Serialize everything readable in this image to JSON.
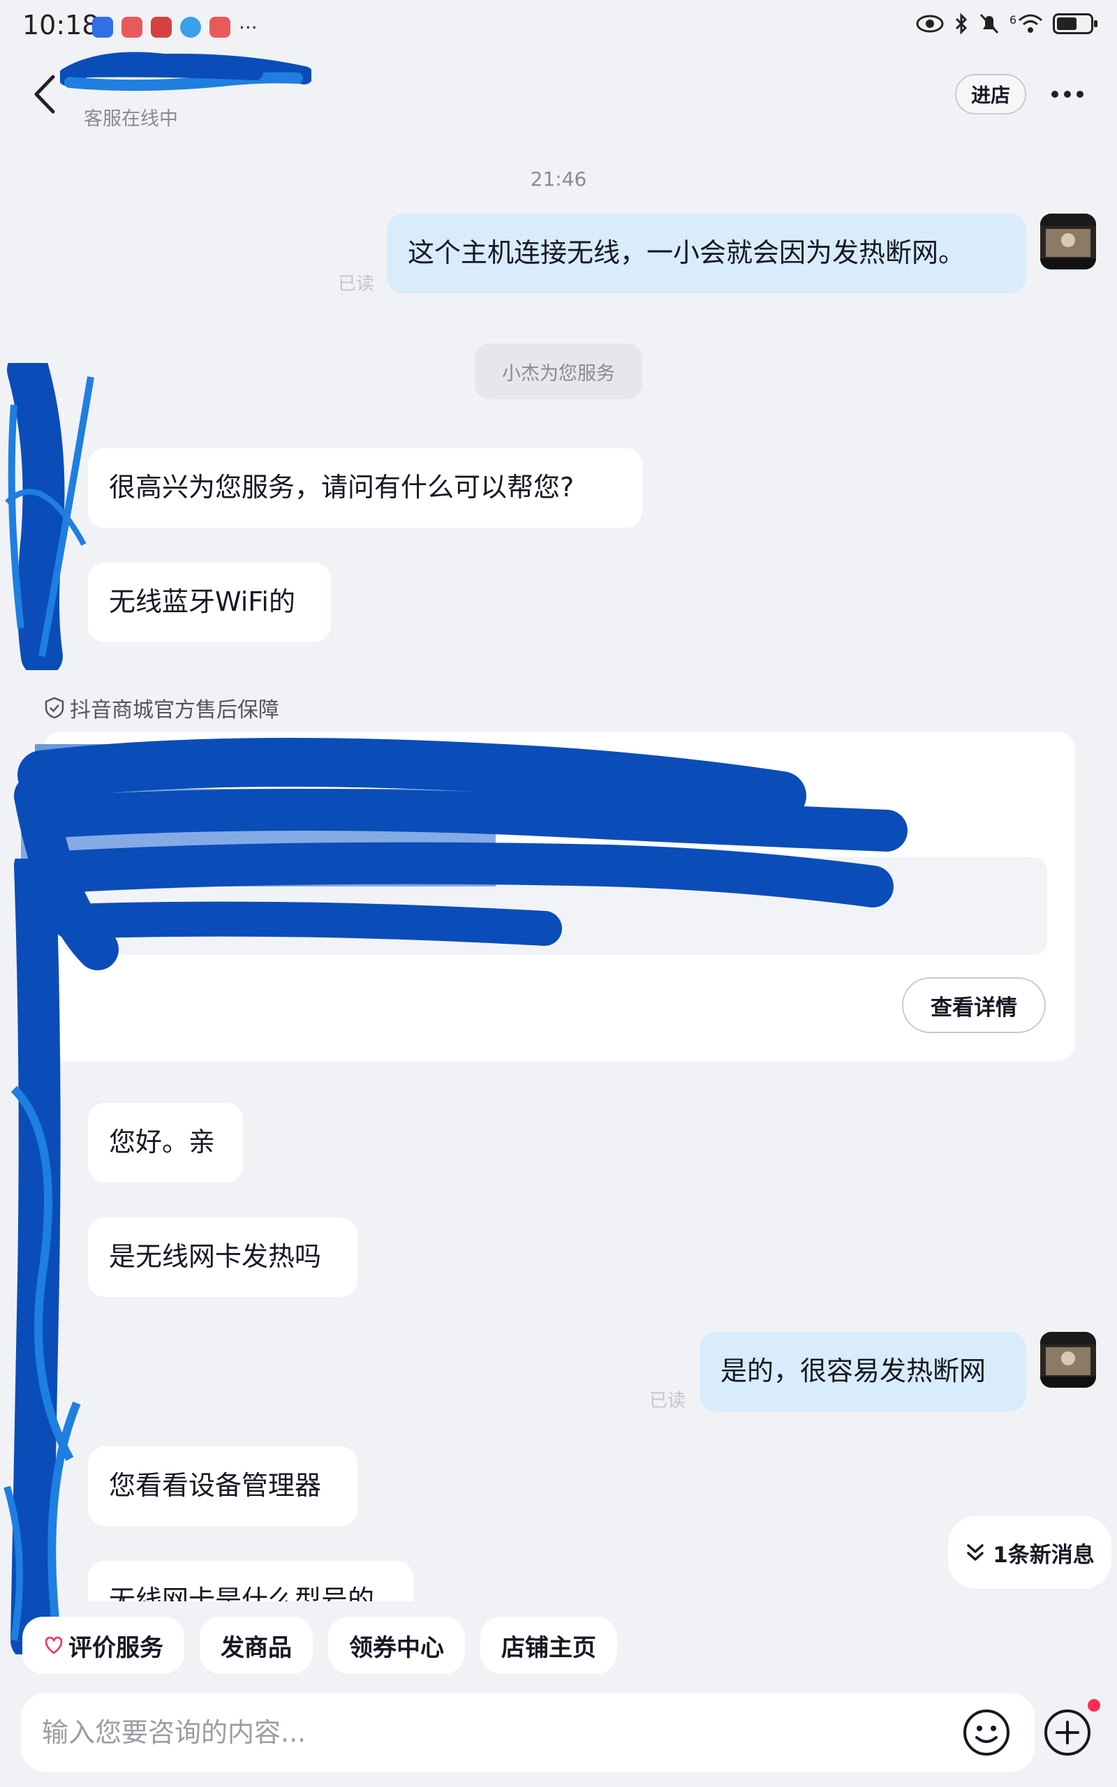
{
  "status_bar": {
    "time": "10:18",
    "network_label": "6",
    "battery_level": 0.6,
    "more_indicator": "···"
  },
  "header": {
    "subtitle": "客服在线中",
    "enter_store_label": "进店"
  },
  "chat": {
    "timestamp": "21:46",
    "read_label": "已读",
    "system_notice": "小杰为您服务",
    "messages": [
      {
        "side": "right",
        "text": "这个主机连接无线，一小会就会因为发热断网。"
      },
      {
        "side": "left",
        "text": "很高兴为您服务，请问有什么可以帮您?"
      },
      {
        "side": "left",
        "text": "无线蓝牙WiFi的"
      },
      {
        "side": "left",
        "text": "您好。亲"
      },
      {
        "side": "left",
        "text": "是无线网卡发热吗"
      },
      {
        "side": "right",
        "text": "是的，很容易发热断网"
      },
      {
        "side": "left",
        "text": "您看看设备管理器"
      },
      {
        "side": "left",
        "text": "无线网卡是什么型号的"
      }
    ]
  },
  "product_card": {
    "guarantee": "抖音商城官方售后保障",
    "detail_button": "查看详情"
  },
  "new_message": {
    "label": "1条新消息"
  },
  "quick_actions": [
    "评价服务",
    "发商品",
    "领券中心",
    "店铺主页"
  ],
  "composer": {
    "placeholder": "输入您要咨询的内容..."
  },
  "colors": {
    "background": "#f1f2f5",
    "self_bubble": "#d8ecfc",
    "other_bubble": "#ffffff",
    "redaction": "#0a4db8",
    "notification_dot": "#fe2c55"
  }
}
